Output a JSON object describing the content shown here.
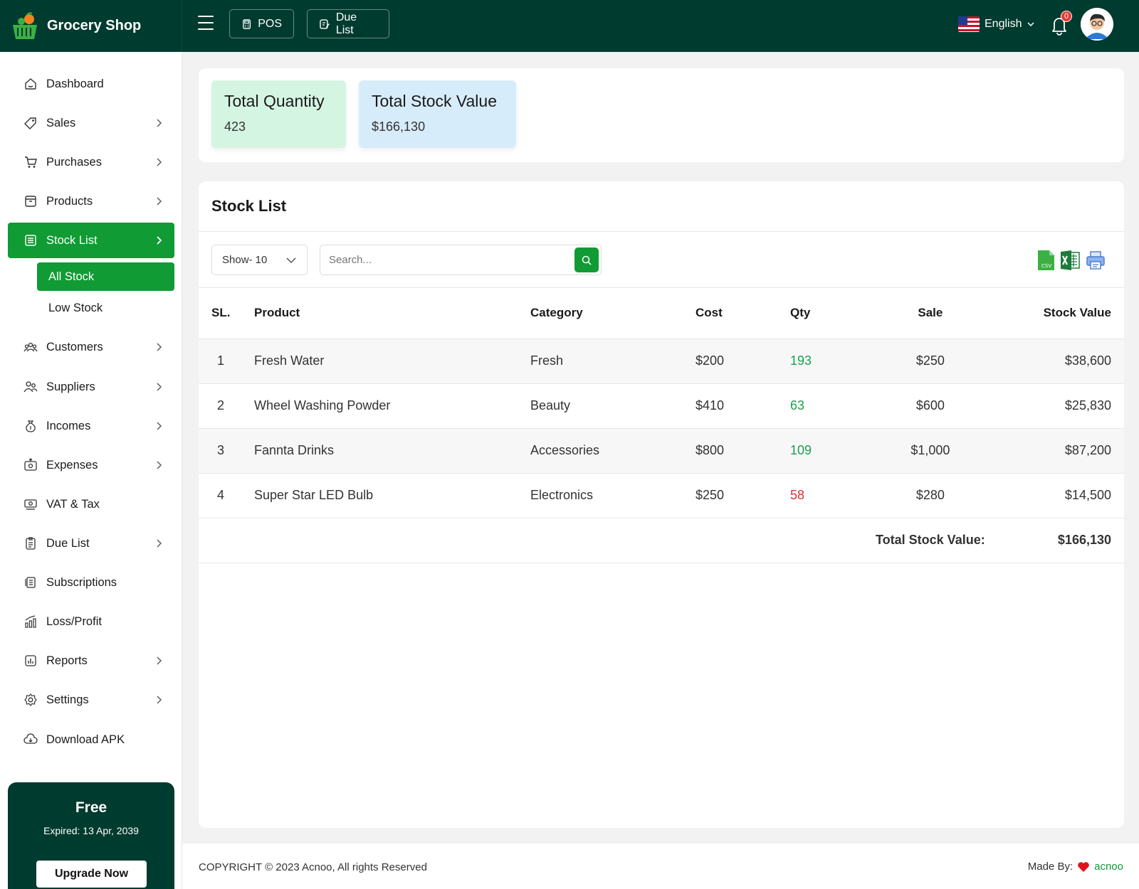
{
  "brand": {
    "name": "Grocery Shop",
    "logo": "basket-logo"
  },
  "header": {
    "pos_label": "POS",
    "due_label": "Due List",
    "language": "English",
    "notification_count": "0",
    "colors": {
      "bar": "#003b2f",
      "accent": "#109b34"
    }
  },
  "sidebar": {
    "items": [
      {
        "label": "Dashboard",
        "icon": "dashboard-icon"
      },
      {
        "label": "Sales",
        "icon": "tag-icon"
      },
      {
        "label": "Purchases",
        "icon": "cart-icon"
      },
      {
        "label": "Products",
        "icon": "box-icon"
      },
      {
        "label": "Stock List",
        "icon": "list-icon"
      },
      {
        "label": "Customers",
        "icon": "customers-icon"
      },
      {
        "label": "Suppliers",
        "icon": "suppliers-icon"
      },
      {
        "label": "Incomes",
        "icon": "money-bag-icon"
      },
      {
        "label": "Expenses",
        "icon": "expense-icon"
      },
      {
        "label": "VAT & Tax",
        "icon": "cash-icon"
      },
      {
        "label": "Due List",
        "icon": "clipboard-icon"
      },
      {
        "label": "Subscriptions",
        "icon": "subscriptions-icon"
      },
      {
        "label": "Loss/Profit",
        "icon": "chart-icon"
      },
      {
        "label": "Reports",
        "icon": "report-icon"
      },
      {
        "label": "Settings",
        "icon": "gear-icon"
      },
      {
        "label": "Download APK",
        "icon": "cloud-download-icon"
      }
    ],
    "sub_items": [
      {
        "label": "All Stock"
      },
      {
        "label": "Low Stock"
      }
    ]
  },
  "plan": {
    "title": "Free",
    "expiry": "Expired: 13 Apr, 2039",
    "button": "Upgrade Now"
  },
  "summary": {
    "total_quantity_label": "Total Quantity",
    "total_quantity": "423",
    "total_value_label": "Total Stock Value",
    "total_value": "$166,130"
  },
  "stock": {
    "title": "Stock List",
    "show": "Show- 10",
    "search_placeholder": "Search...",
    "exports": [
      "csv-icon",
      "excel-icon",
      "print-icon"
    ],
    "columns": [
      "SL.",
      "Product",
      "Category",
      "Cost",
      "Qty",
      "Sale",
      "Stock Value"
    ],
    "rows": [
      {
        "sl": "1",
        "product": "Fresh Water",
        "category": "Fresh",
        "cost": "$200",
        "qty": "193",
        "sale": "$250",
        "value": "$38,600"
      },
      {
        "sl": "2",
        "product": "Wheel Washing Powder",
        "category": "Beauty",
        "cost": "$410",
        "qty": "63",
        "sale": "$600",
        "value": "$25,830"
      },
      {
        "sl": "3",
        "product": "Fannta Drinks",
        "category": "Accessories",
        "cost": "$800",
        "qty": "109",
        "sale": "$1,000",
        "value": "$87,200"
      },
      {
        "sl": "4",
        "product": "Super Star LED Bulb",
        "category": "Electronics",
        "cost": "$250",
        "qty": "58",
        "sale": "$280",
        "value": "$14,500"
      }
    ],
    "total_label": "Total Stock Value:",
    "total_value": "$166,130"
  },
  "footer": {
    "copyright": "COPYRIGHT © 2023 Acnoo, All rights Reserved",
    "made_by": "Made By:",
    "made_by_brand": "acnoo"
  }
}
